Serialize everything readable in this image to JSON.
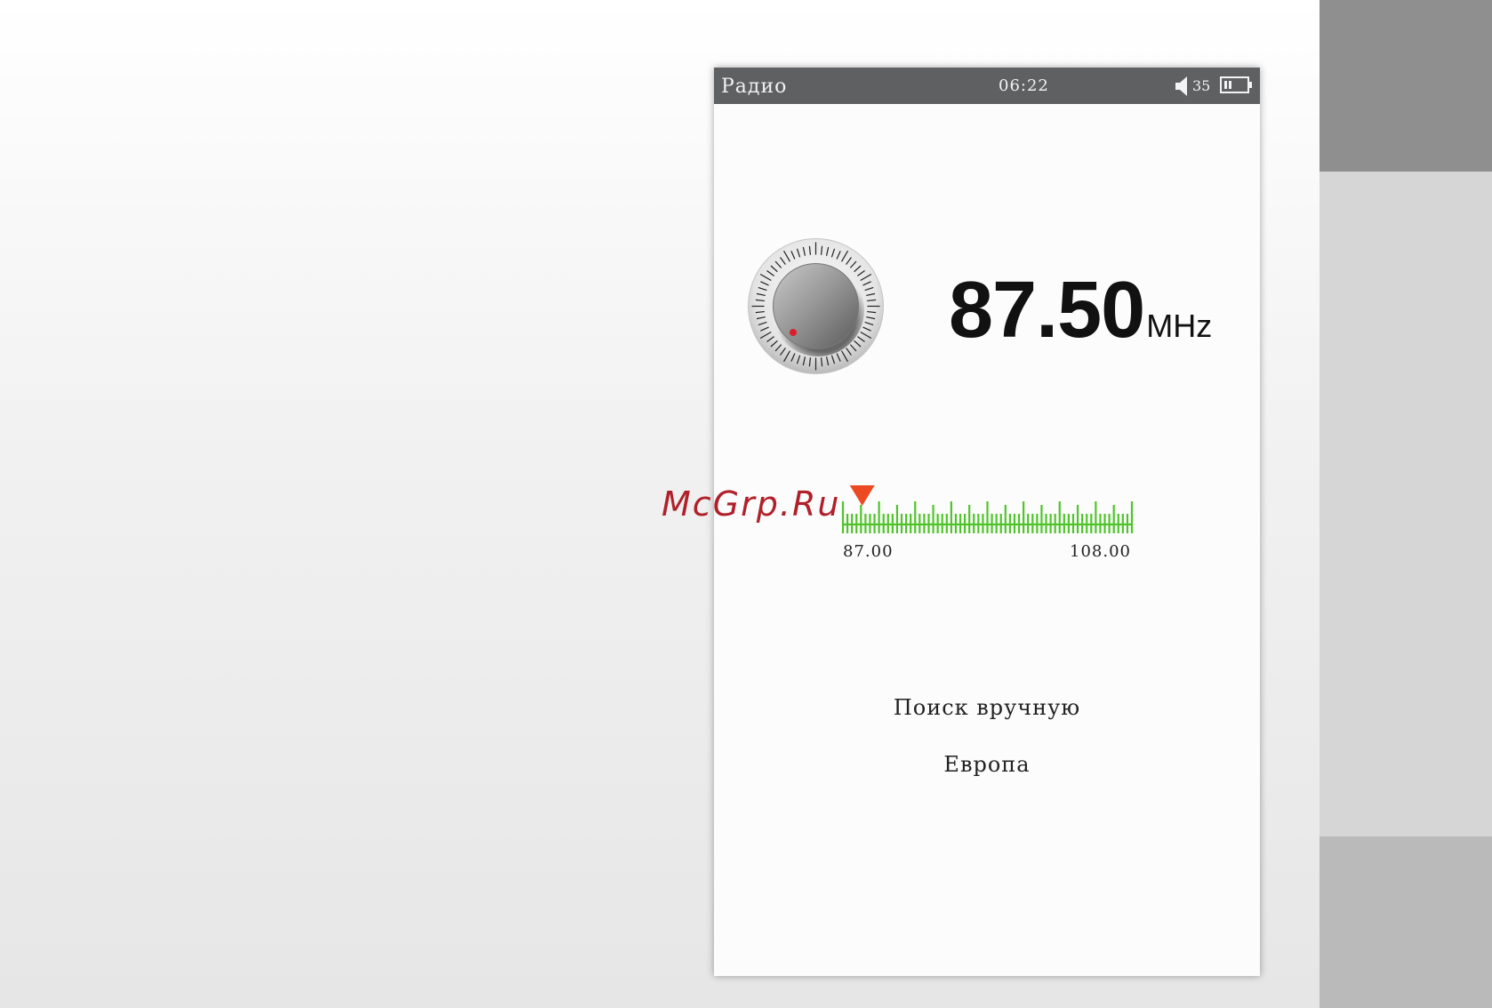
{
  "statusbar": {
    "title": "Радио",
    "time": "06:22",
    "volume": "35",
    "speaker_icon": "speaker-icon",
    "battery_icon": "battery-icon"
  },
  "tuner": {
    "frequency": "87.50",
    "unit": "MHz",
    "knob_icon": "tuning-knob-icon",
    "scale": {
      "min_label": "87.00",
      "max_label": "108.00",
      "min": 87.0,
      "max": 108.0,
      "current": 87.5
    }
  },
  "menu": {
    "items": [
      "Поиск вручную",
      "Европа"
    ]
  },
  "watermark": "McGrp.Ru",
  "colors": {
    "statusbar": "#5f6062",
    "scale": "#4fc42a",
    "marker": "#ec4a22",
    "knob_dot": "#d8202a",
    "watermark": "#b0202a"
  }
}
